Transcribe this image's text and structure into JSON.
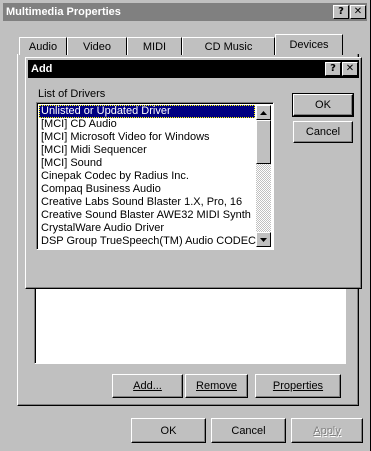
{
  "main_window": {
    "title": "Multimedia Properties",
    "help_label": "?",
    "close_label": "✕"
  },
  "tabs": [
    {
      "label": "Audio"
    },
    {
      "label": "Video"
    },
    {
      "label": "MIDI"
    },
    {
      "label": "CD Music"
    },
    {
      "label": "Devices",
      "selected": true
    }
  ],
  "devices_panel": {
    "add_label": "Add...",
    "remove_label": "Remove",
    "properties_label": "Properties"
  },
  "bottom_buttons": {
    "ok_label": "OK",
    "cancel_label": "Cancel",
    "apply_label": "Apply"
  },
  "add_dialog": {
    "title": "Add",
    "help_label": "?",
    "close_label": "✕",
    "list_label": "List of Drivers",
    "ok_label": "OK",
    "cancel_label": "Cancel",
    "drivers": [
      "Unlisted or Updated Driver",
      "[MCI] CD Audio",
      "[MCI] Microsoft Video for Windows",
      "[MCI] Midi Sequencer",
      "[MCI] Sound",
      "Cinepak Codec by Radius Inc.",
      "Compaq Business Audio",
      "Creative Labs Sound Blaster 1.X, Pro, 16",
      "Creative Sound Blaster AWE32 MIDI Synth",
      "CrystalWare Audio Driver",
      "DSP Group TrueSpeech(TM) Audio CODEC"
    ],
    "selected_index": 0
  },
  "colors": {
    "face": "#c0c0c0",
    "active_title": "#000000",
    "inactive_title": "#808080",
    "selection": "#000080"
  }
}
